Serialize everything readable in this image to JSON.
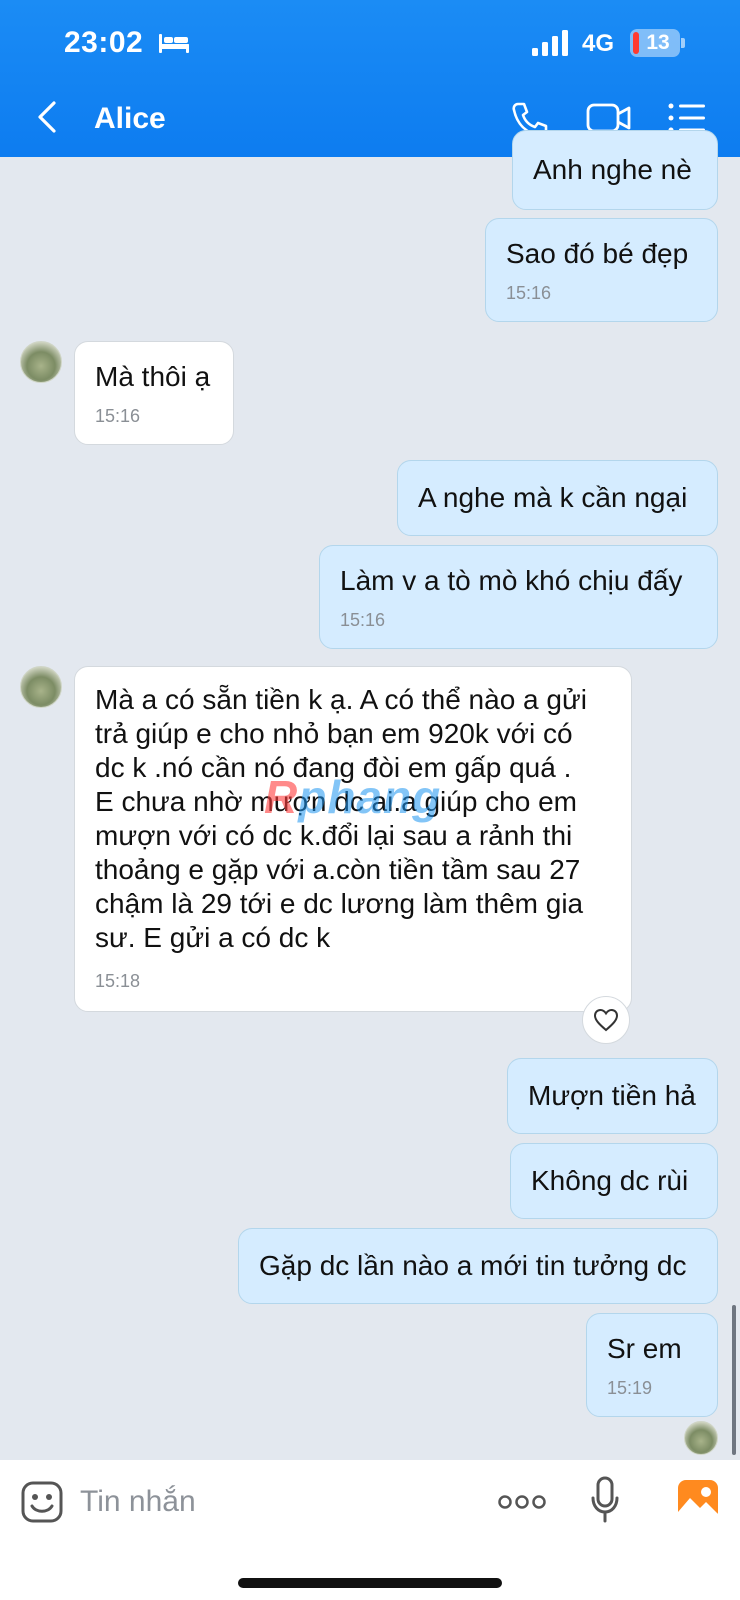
{
  "status_bar": {
    "time": "23:02",
    "network": "4G",
    "battery": "13"
  },
  "header": {
    "title": "Alice"
  },
  "messages": [
    {
      "text": "Anh nghe nè",
      "time": ""
    },
    {
      "text": "Sao đó bé đẹp",
      "time": "15:16"
    },
    {
      "text": "Mà thôi ạ",
      "time": "15:16"
    },
    {
      "text": "A nghe mà k cần ngại",
      "time": ""
    },
    {
      "text": "Làm v a tò mò khó chịu đấy",
      "time": "15:16"
    },
    {
      "lines": [
        "Mà a có sẵn tiền k ạ. A có thể nào a gửi",
        "trả giúp e cho nhỏ bạn em 920k với có",
        "dc k .nó cần nó đang đòi em gấp quá .",
        "E chưa nhờ mượn dc ai.a giúp cho em",
        "mượn với có dc k.đổi lại sau a rảnh thi",
        "thoảng e gặp với a.còn tiền tầm sau 27",
        "chậm là 29 tới e dc lương làm thêm gia",
        "sư. E gửi a có dc k"
      ],
      "time": "15:18"
    },
    {
      "text": "Mượn tiền hả",
      "time": ""
    },
    {
      "text": "Không dc rùi",
      "time": ""
    },
    {
      "text": "Gặp dc lần nào a mới tin tưởng dc",
      "time": ""
    },
    {
      "text": "Sr em",
      "time": "15:19"
    }
  ],
  "watermark": {
    "r": "R",
    "rest": "phang"
  },
  "composer": {
    "placeholder": "Tin nhắn"
  },
  "colors": {
    "header": "#0d7cf0",
    "outgoing_bubble": "#d5ecff",
    "incoming_bubble": "#ffffff",
    "background": "#e3e8ef",
    "gallery": "#ff8a1f"
  },
  "icons": [
    "bed-icon",
    "signal-icon",
    "battery-icon",
    "back-icon",
    "call-icon",
    "video-icon",
    "menu-icon",
    "heart-icon",
    "emoji-icon",
    "more-icon",
    "mic-icon",
    "gallery-icon"
  ]
}
